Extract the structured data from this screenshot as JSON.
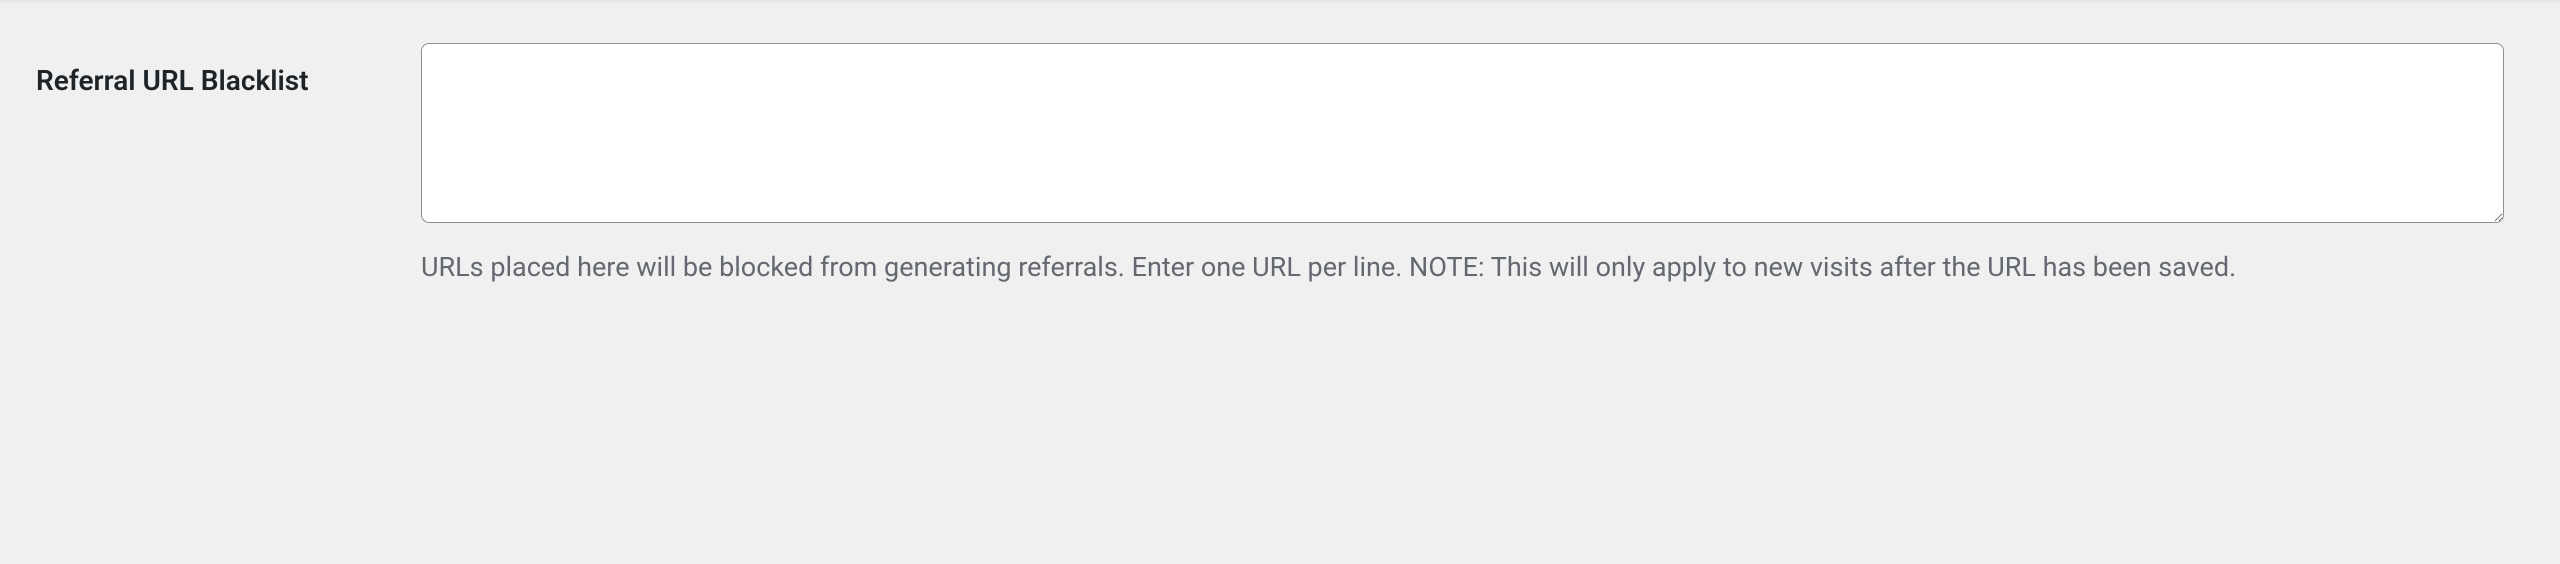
{
  "form": {
    "referral_blacklist": {
      "label": "Referral URL Blacklist",
      "value": "",
      "description": "URLs placed here will be blocked from generating referrals. Enter one URL per line. NOTE: This will only apply to new visits after the URL has been saved."
    }
  }
}
